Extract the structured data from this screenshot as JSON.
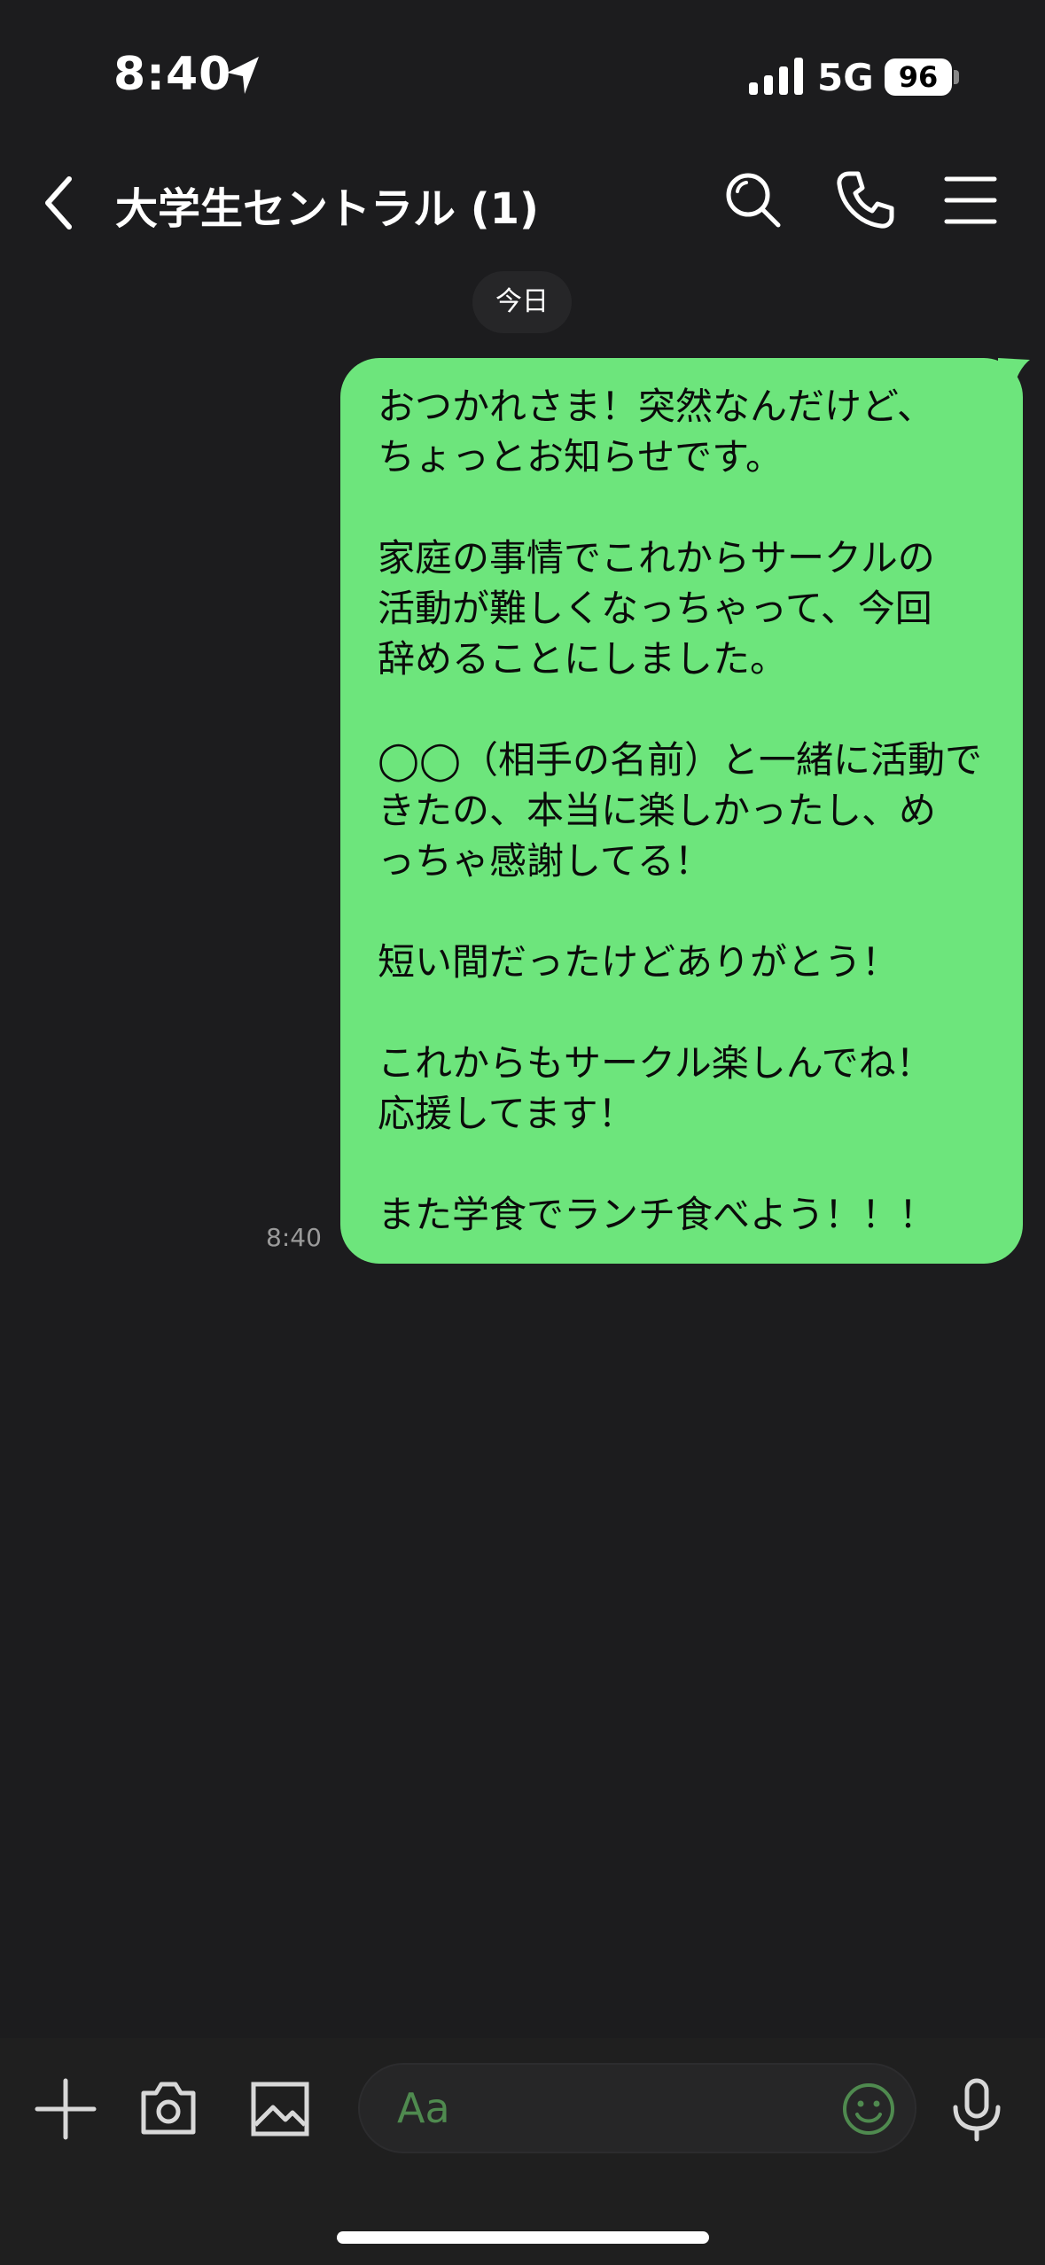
{
  "status_bar": {
    "time": "8:40",
    "network": "5G",
    "battery": "96"
  },
  "header": {
    "title": "大学生セントラル (1)"
  },
  "date_separator": "今日",
  "message": {
    "time": "8:40",
    "lines": [
      "おつかれさま！突然なんだけど、",
      "ちょっとお知らせです。",
      "",
      "家庭の事情でこれからサークルの",
      "活動が難しくなっちゃって、今回",
      "辞めることにしました。",
      "",
      "◯◯（相手の名前）と一緒に活動で",
      "きたの、本当に楽しかったし、め",
      "っちゃ感謝してる！",
      "",
      "短い間だったけどありがとう！",
      "",
      "これからもサークル楽しんでね！",
      "応援してます！",
      "",
      "また学食でランチ食べよう！！！"
    ]
  },
  "composer": {
    "placeholder": "Aa"
  },
  "colors": {
    "bubble": "#6de57c",
    "background": "#1c1c1e"
  }
}
